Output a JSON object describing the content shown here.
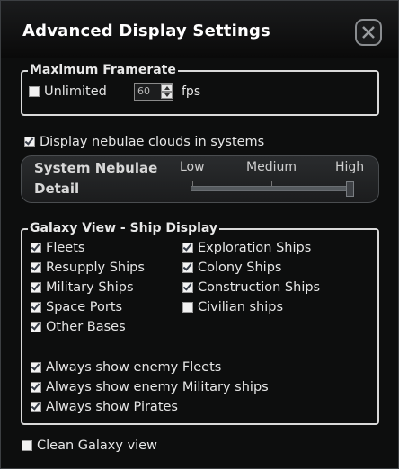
{
  "dialog": {
    "title": "Advanced Display Settings"
  },
  "framerate": {
    "legend": "Maximum Framerate",
    "unlimited_label": "Unlimited",
    "unlimited_checked": false,
    "value": "60",
    "unit": "fps"
  },
  "nebulae": {
    "clouds_label": "Display nebulae clouds in systems",
    "clouds_checked": true,
    "detail_title_line1": "System Nebulae",
    "detail_title_line2": "Detail",
    "levels": [
      "Low",
      "Medium",
      "High"
    ],
    "selected_level": "High"
  },
  "galaxy_view": {
    "legend": "Galaxy View - Ship Display",
    "left_items": [
      {
        "label": "Fleets",
        "checked": true
      },
      {
        "label": "Resupply Ships",
        "checked": true
      },
      {
        "label": "Military Ships",
        "checked": true
      },
      {
        "label": "Space Ports",
        "checked": true
      },
      {
        "label": "Other Bases",
        "checked": true
      }
    ],
    "right_items": [
      {
        "label": "Exploration Ships",
        "checked": true
      },
      {
        "label": "Colony Ships",
        "checked": true
      },
      {
        "label": "Construction Ships",
        "checked": true
      },
      {
        "label": "Civilian ships",
        "checked": false
      }
    ],
    "enemy_items": [
      {
        "label": "Always show enemy Fleets",
        "checked": true
      },
      {
        "label": "Always show enemy Military ships",
        "checked": true
      },
      {
        "label": "Always show Pirates",
        "checked": true
      }
    ]
  },
  "clean_view": {
    "label": "Clean Galaxy view",
    "checked": false
  }
}
